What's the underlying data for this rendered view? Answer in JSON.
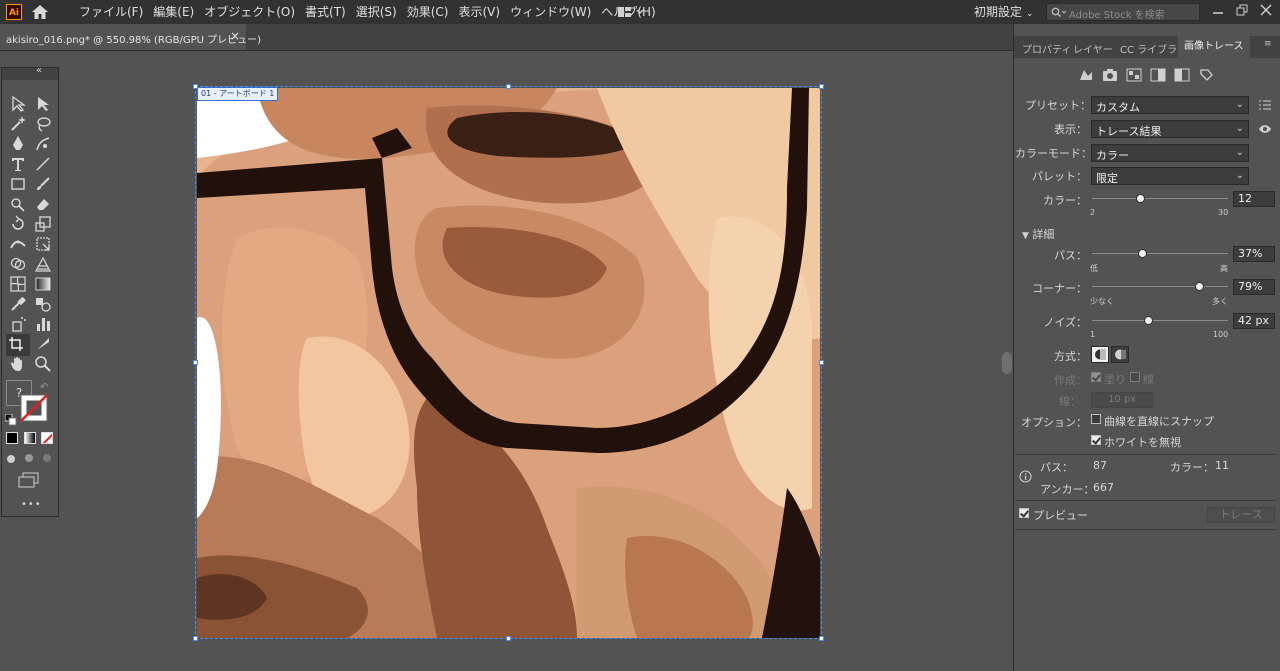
{
  "app": {
    "logo": "Ai",
    "workspace": "初期設定"
  },
  "menu": [
    "ファイル(F)",
    "編集(E)",
    "オブジェクト(O)",
    "書式(T)",
    "選択(S)",
    "効果(C)",
    "表示(V)",
    "ウィンドウ(W)",
    "ヘルプ(H)"
  ],
  "search": {
    "placeholder": "Adobe Stock を検索"
  },
  "document": {
    "tab_title": "akisiro_016.png* @ 550.98% (RGB/GPU プレビュー)",
    "close": "×",
    "artboard_label": "01 - アートボード 1"
  },
  "toolbar": {
    "collapse": "«",
    "unknown": "?",
    "more": "•••"
  },
  "panel": {
    "tabs": [
      "プロパティ",
      "レイヤー",
      "CC ライブラリ",
      "画像トレース"
    ],
    "active_tab": "画像トレース",
    "preset_label": "プリセット：",
    "preset_value": "カスタム",
    "view_label": "表示：",
    "view_value": "トレース結果",
    "mode_label": "カラーモード：",
    "mode_value": "カラー",
    "palette_label": "パレット：",
    "palette_value": "限定",
    "colors_label": "カラー：",
    "colors_value": "12",
    "colors_min": "2",
    "colors_max": "30",
    "colors_fraction": 0.357,
    "advanced_label": "詳細",
    "paths_label": "パス：",
    "paths_value": "37%",
    "paths_low": "低",
    "paths_high": "高",
    "paths_fraction": 0.37,
    "corners_label": "コーナー：",
    "corners_value": "79%",
    "corners_low": "少なく",
    "corners_high": "多く",
    "corners_fraction": 0.79,
    "noise_label": "ノイズ：",
    "noise_value": "42 px",
    "noise_min": "1",
    "noise_max": "100",
    "noise_fraction": 0.414,
    "method_label": "方式：",
    "create_label": "作成：",
    "fill_label": "塗り",
    "stroke_label": "線",
    "stroke_width_label": "線：",
    "stroke_width_value": "10 px",
    "options_label": "オプション：",
    "snap_label": "曲線を直線にスナップ",
    "ignore_white_label": "ホワイトを無視",
    "info_paths_label": "パス：",
    "info_paths_value": "87",
    "info_colors_label": "カラー：",
    "info_colors_value": "11",
    "info_anchors_label": "アンカー：",
    "info_anchors_value": "667",
    "preview_label": "プレビュー",
    "trace_button": "トレース"
  }
}
